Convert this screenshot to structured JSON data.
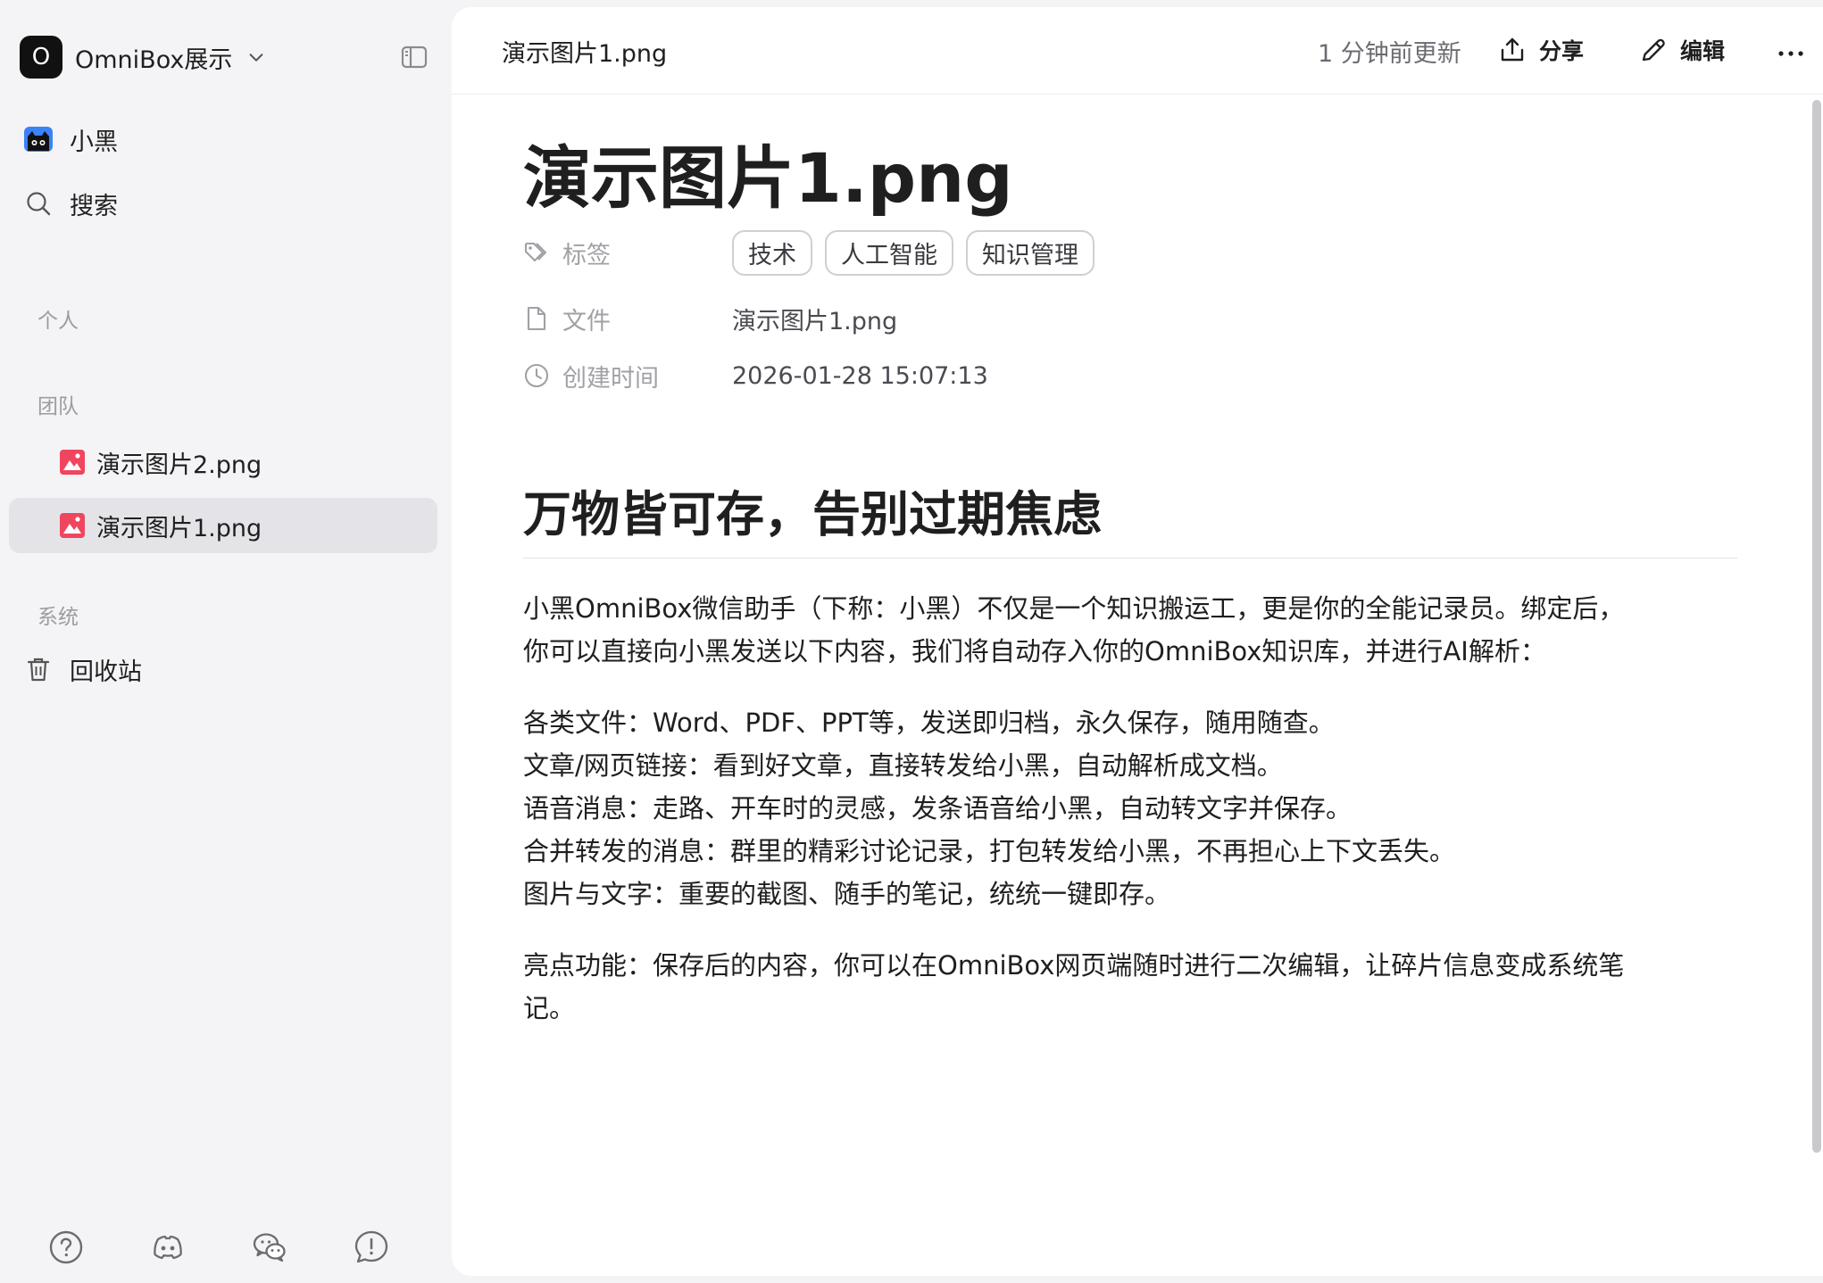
{
  "sidebar": {
    "workspace": {
      "initial": "O",
      "name": "OmniBox展示"
    },
    "nav": [
      {
        "label": "小黑",
        "icon": "cat-avatar-icon"
      },
      {
        "label": "搜索",
        "icon": "search-icon"
      }
    ],
    "sections": {
      "personal": "个人",
      "team": "团队",
      "system": "系统"
    },
    "team_items": [
      {
        "label": "演示图片2.png",
        "icon": "image-file-icon",
        "active": false
      },
      {
        "label": "演示图片1.png",
        "icon": "image-file-icon",
        "active": true
      }
    ],
    "system_items": [
      {
        "label": "回收站",
        "icon": "trash-icon"
      }
    ],
    "footer_icons": [
      "help-icon",
      "discord-icon",
      "wechat-icon",
      "feedback-icon"
    ]
  },
  "topbar": {
    "breadcrumb": "演示图片1.png",
    "updated": "1 分钟前更新",
    "share_label": "分享",
    "edit_label": "编辑"
  },
  "document": {
    "title": "演示图片1.png",
    "properties": {
      "tags_key": "标签",
      "tags": [
        "技术",
        "人工智能",
        "知识管理"
      ],
      "file_key": "文件",
      "file_value": "演示图片1.png",
      "created_key": "创建时间",
      "created_value": "2026-01-28 15:07:13"
    },
    "heading": "万物皆可存，告别过期焦虑",
    "intro": [
      "小黑OmniBox微信助手（下称：小黑）不仅是一个知识搬运工，更是你的全能记录员。绑定后，",
      "你可以直接向小黑发送以下内容，我们将自动存入你的OmniBox知识库，并进行AI解析："
    ],
    "list": [
      "各类文件：Word、PDF、PPT等，发送即归档，永久保存，随用随查。",
      "文章/网页链接：看到好文章，直接转发给小黑，自动解析成文档。",
      "语音消息：走路、开车时的灵感，发条语音给小黑，自动转文字并保存。",
      "合并转发的消息：群里的精彩讨论记录，打包转发给小黑，不再担心上下文丢失。",
      "图片与文字：重要的截图、随手的笔记，统统一键即存。"
    ],
    "highlight": [
      "亮点功能：保存后的内容，你可以在OmniBox网页端随时进行二次编辑，让碎片信息变成系统笔",
      "记。"
    ]
  },
  "colors": {
    "image_file": "#f0455f",
    "sidebar_bg": "#f4f4f6",
    "active_bg": "#e4e4e8"
  }
}
